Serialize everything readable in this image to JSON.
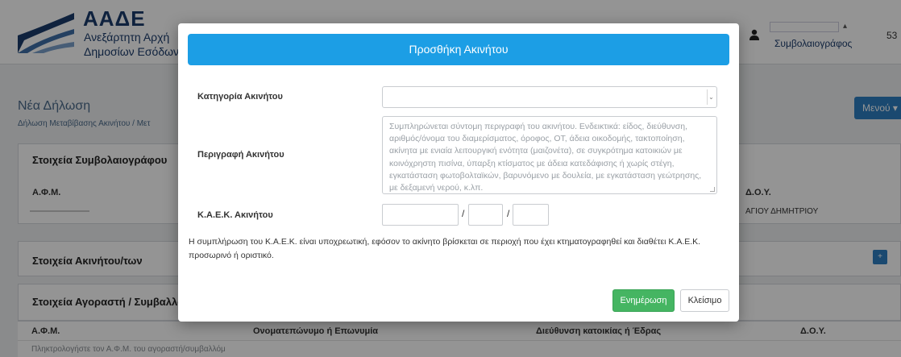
{
  "colors": {
    "header_blue": "#1c9ee5",
    "update_green": "#45b562",
    "brand_navy": "#1b3b6b",
    "menu_blue": "#2d7fc1"
  },
  "brand": {
    "title": "ΑΑΔΕ",
    "subtitle_line1": "Ανεξάρτητη Αρχή",
    "subtitle_line2": "Δημοσίων Εσόδων"
  },
  "user": {
    "role": "Συμβολαιογράφος",
    "number": "53",
    "icon": "user-icon"
  },
  "background": {
    "page_title": "Νέα Δήλωση",
    "breadcrumb": "Δήλωση Μεταβίβασης Ακινήτου  /  Μετ",
    "menu_label": "Μενού  ▾",
    "notary_panel_title": "Στοιχεία Συμβολαιογράφου",
    "afm_label": "Α.Φ.Μ.",
    "doy_label": "Δ.Ο.Υ.",
    "doy_value": "ΑΓΙΟΥ ΔΗΜΗΤΡΙΟΥ",
    "property_panel_title": "Στοιχεία Ακινήτου/των",
    "plus_label": "+",
    "buyer_panel_title": "Στοιχεία Αγοραστή / Συμβαλλόμ",
    "table_headers": [
      "Α.Φ.Μ.",
      "Ονοματεπώνυμο ή Επωνυμία",
      "Διεύθυνση κατοικίας ή Έδρας",
      "Δ.Ο.Υ."
    ],
    "table_first_cell": "Πληκτρολογήστε τον Α.Φ.Μ. του αγοραστή/συμβαλλόμ"
  },
  "modal": {
    "title": "Προσθήκη Ακινήτου",
    "category_label": "Κατηγορία Ακινήτου",
    "category_value": "",
    "description_label": "Περιγραφή Ακινήτου",
    "description_placeholder": "Συμπληρώνεται σύντομη περιγραφή του ακινήτου. Ενδεικτικά: είδος, διεύθυνση, αριθμός/όνομα του διαμερίσματος, όροφος, ΟΤ, άδεια οικοδομής, τακτοποίηση, ακίνητα με ενιαία λειτουργική ενότητα (μαιζονέτα), σε συγκρότημα κατοικιών με κοινόχρηστη πισίνα, ύπαρξη κτίσματος με άδεια κατεδάφισης ή χωρίς στέγη, εγκατάσταση φωτοβολταϊκών, βαρυνόμενο με δουλεία, με εγκατάσταση γεώτρησης, με δεξαμενή νερού, κ.λπ.",
    "kaek_label": "Κ.Α.Ε.Κ. Ακινήτου",
    "kaek_separator": "/",
    "kaek_part1": "",
    "kaek_part2": "",
    "kaek_part3": "",
    "info_text": "Η συμπλήρωση του Κ.Α.Ε.Κ. είναι υποχρεωτική, εφόσον το ακίνητο βρίσκεται σε περιοχή που έχει κτηματογραφηθεί και διαθέτει Κ.Α.Ε.Κ. προσωρινό ή οριστικό.",
    "update_button": "Ενημέρωση",
    "close_button": "Κλείσιμο"
  }
}
